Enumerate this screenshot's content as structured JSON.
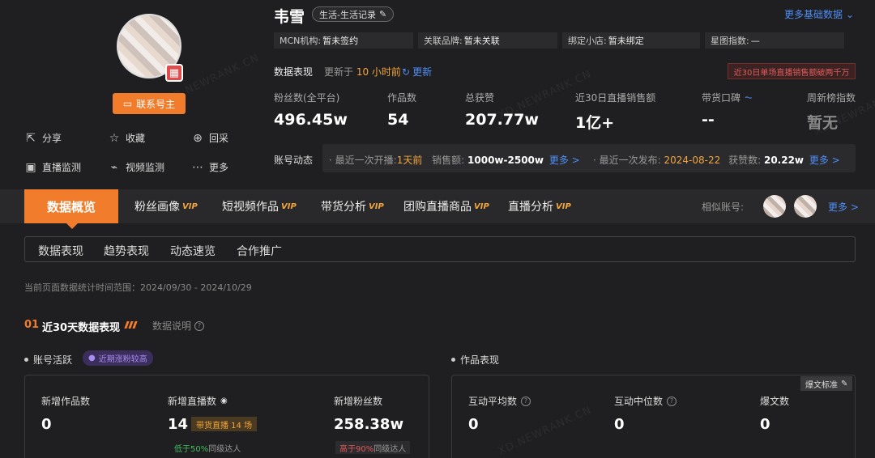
{
  "profile": {
    "contact_label": "联系号主",
    "actions": [
      {
        "icon": "share-icon",
        "label": "分享"
      },
      {
        "icon": "star-icon",
        "label": "收藏"
      },
      {
        "icon": "login-icon",
        "label": "回采"
      },
      {
        "icon": "tv-icon",
        "label": "直播监测"
      },
      {
        "icon": "chart-icon",
        "label": "视频监测"
      },
      {
        "icon": "more-dots-icon",
        "label": "更多"
      }
    ]
  },
  "header": {
    "name": "韦雪",
    "category_tag": "生活-生活记录",
    "more_basic": "更多基础数据",
    "info": [
      {
        "label": "MCN机构:",
        "value": "暂未签约"
      },
      {
        "label": "关联品牌:",
        "value": "暂未关联"
      },
      {
        "label": "绑定小店:",
        "value": "暂未绑定"
      },
      {
        "label": "星图指数:",
        "value": "—"
      }
    ]
  },
  "performance": {
    "label": "数据表现",
    "updated_prefix": "更新于",
    "updated_value": "10 小时前",
    "refresh": "更新",
    "alert": "近30日单场直播销售额破两千万",
    "metrics": [
      {
        "label": "粉丝数(全平台)",
        "value": "496.45w"
      },
      {
        "label": "作品数",
        "value": "54"
      },
      {
        "label": "总获赞",
        "value": "207.77w"
      },
      {
        "label": "近30日直播销售额",
        "value": "1亿+"
      },
      {
        "label": "带货口碑",
        "value": "--"
      },
      {
        "label": "周新榜指数",
        "value": "暂无"
      }
    ]
  },
  "dynamics": {
    "label": "账号动态",
    "live_prefix": "· 最近一次开播:",
    "live_time": "1天前",
    "sales_label": "销售额:",
    "sales_value": "1000w-2500w",
    "more1": "更多 >",
    "post_prefix": "· 最近一次发布:",
    "post_date": "2024-08-22",
    "likes_label": "获赞数:",
    "likes_value": "20.22w",
    "more2": "更多 >"
  },
  "tabs": {
    "active": "数据概览",
    "items": [
      {
        "label": "粉丝画像",
        "vip": "VIP"
      },
      {
        "label": "短视频作品",
        "vip": "VIP"
      },
      {
        "label": "带货分析",
        "vip": "VIP"
      },
      {
        "label": "团购直播商品",
        "vip": "VIP"
      },
      {
        "label": "直播分析",
        "vip": "VIP"
      }
    ],
    "similar_label": "相似账号:",
    "similar_more": "更多 >"
  },
  "subtabs": [
    "数据表现",
    "趋势表现",
    "动态速览",
    "合作推广"
  ],
  "date_range": "当前页面数据统计时间范围：2024/09/30 - 2024/10/29",
  "section": {
    "num": "01",
    "title": "近30天数据表现",
    "desc": "数据说明"
  },
  "account_activity": {
    "title": "账号活跃",
    "badge": "近期涨粉较高",
    "cards": [
      {
        "label": "新增作品数",
        "value": "0"
      },
      {
        "label": "新增直播数",
        "value": "14",
        "badge": "带货直播 14 场",
        "cmp_colored": "低于50%",
        "cmp_rest": "同级达人"
      },
      {
        "label": "新增粉丝数",
        "value": "258.38w",
        "cmp_colored": "高于90%",
        "cmp_rest": "同级达人"
      }
    ]
  },
  "works_performance": {
    "title": "作品表现",
    "burst_tag": "爆文标准",
    "cards": [
      {
        "label": "互动平均数",
        "value": "0"
      },
      {
        "label": "互动中位数",
        "value": "0"
      },
      {
        "label": "爆文数",
        "value": "0"
      }
    ]
  },
  "watermark": "XD.NEWRANK.CN",
  "colors": {
    "accent": "#f17c2b",
    "link": "#4f8ff7",
    "vip": "#f3a53c",
    "alert": "#e05a5a"
  }
}
